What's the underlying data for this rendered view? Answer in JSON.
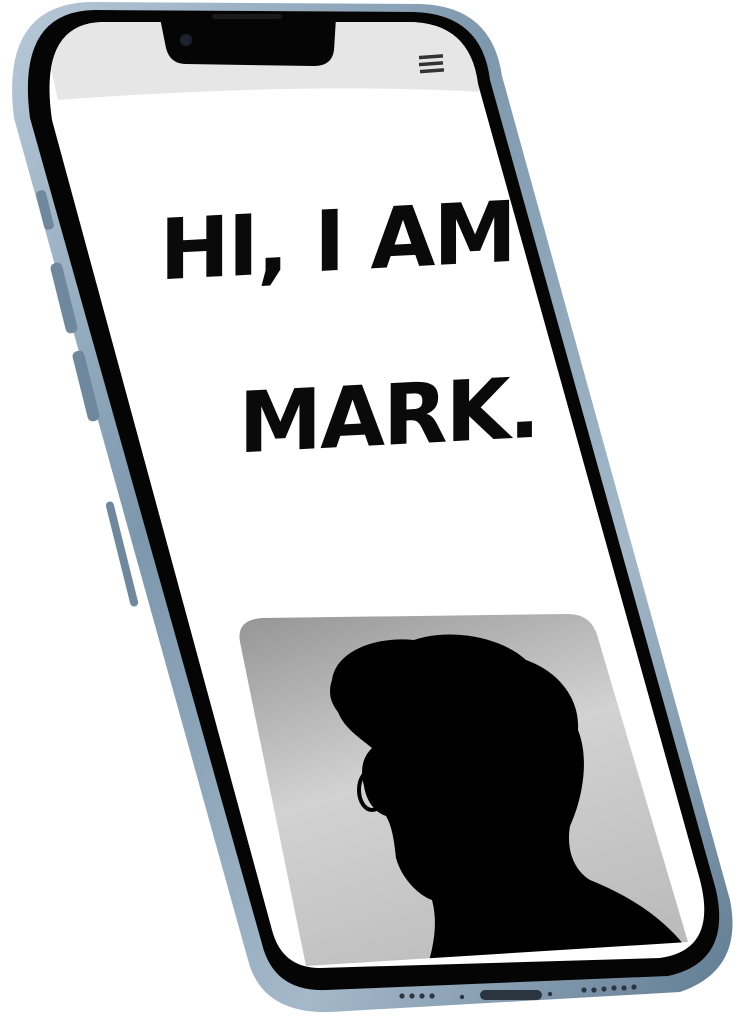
{
  "hero": {
    "line1": "HI, I AM",
    "line2": "MARK."
  },
  "header": {
    "menu_icon": "hamburger-menu-icon"
  },
  "profile_photo": {
    "icon": "person-silhouette-icon"
  },
  "colors": {
    "screen_background": "#ffffff",
    "header_band": "#e6e6e6",
    "headline_text": "#0a0a0a",
    "phone_frame": "#8ea6bb",
    "phone_bezel": "#050505"
  }
}
